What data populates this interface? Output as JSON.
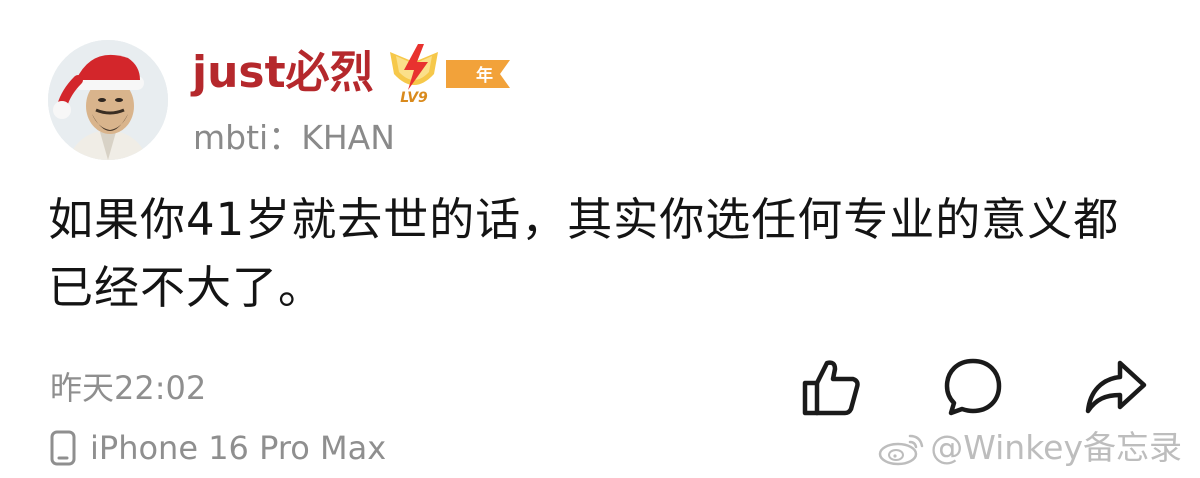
{
  "user": {
    "name": "just必烈",
    "subtitle": "mbti：KHAN",
    "badge": {
      "level": "LV9",
      "year_label": "年"
    }
  },
  "post": {
    "text": "如果你41岁就去世的话，其实你选任何专业的意义都已经不大了。",
    "time": "昨天22:02",
    "device": "iPhone 16 Pro Max"
  },
  "actions": [
    {
      "icon": "thumbs-up-icon"
    },
    {
      "icon": "comment-bubble-icon"
    },
    {
      "icon": "share-arrow-icon"
    }
  ],
  "watermark": {
    "text": "@Winkey备忘录",
    "icon": "weibo-logo-icon"
  },
  "colors": {
    "username": "#b5282c",
    "meta": "#8f8f8f",
    "text": "#141414",
    "badge_orange": "#f2a23a",
    "watermark": "#bdbdbd"
  }
}
